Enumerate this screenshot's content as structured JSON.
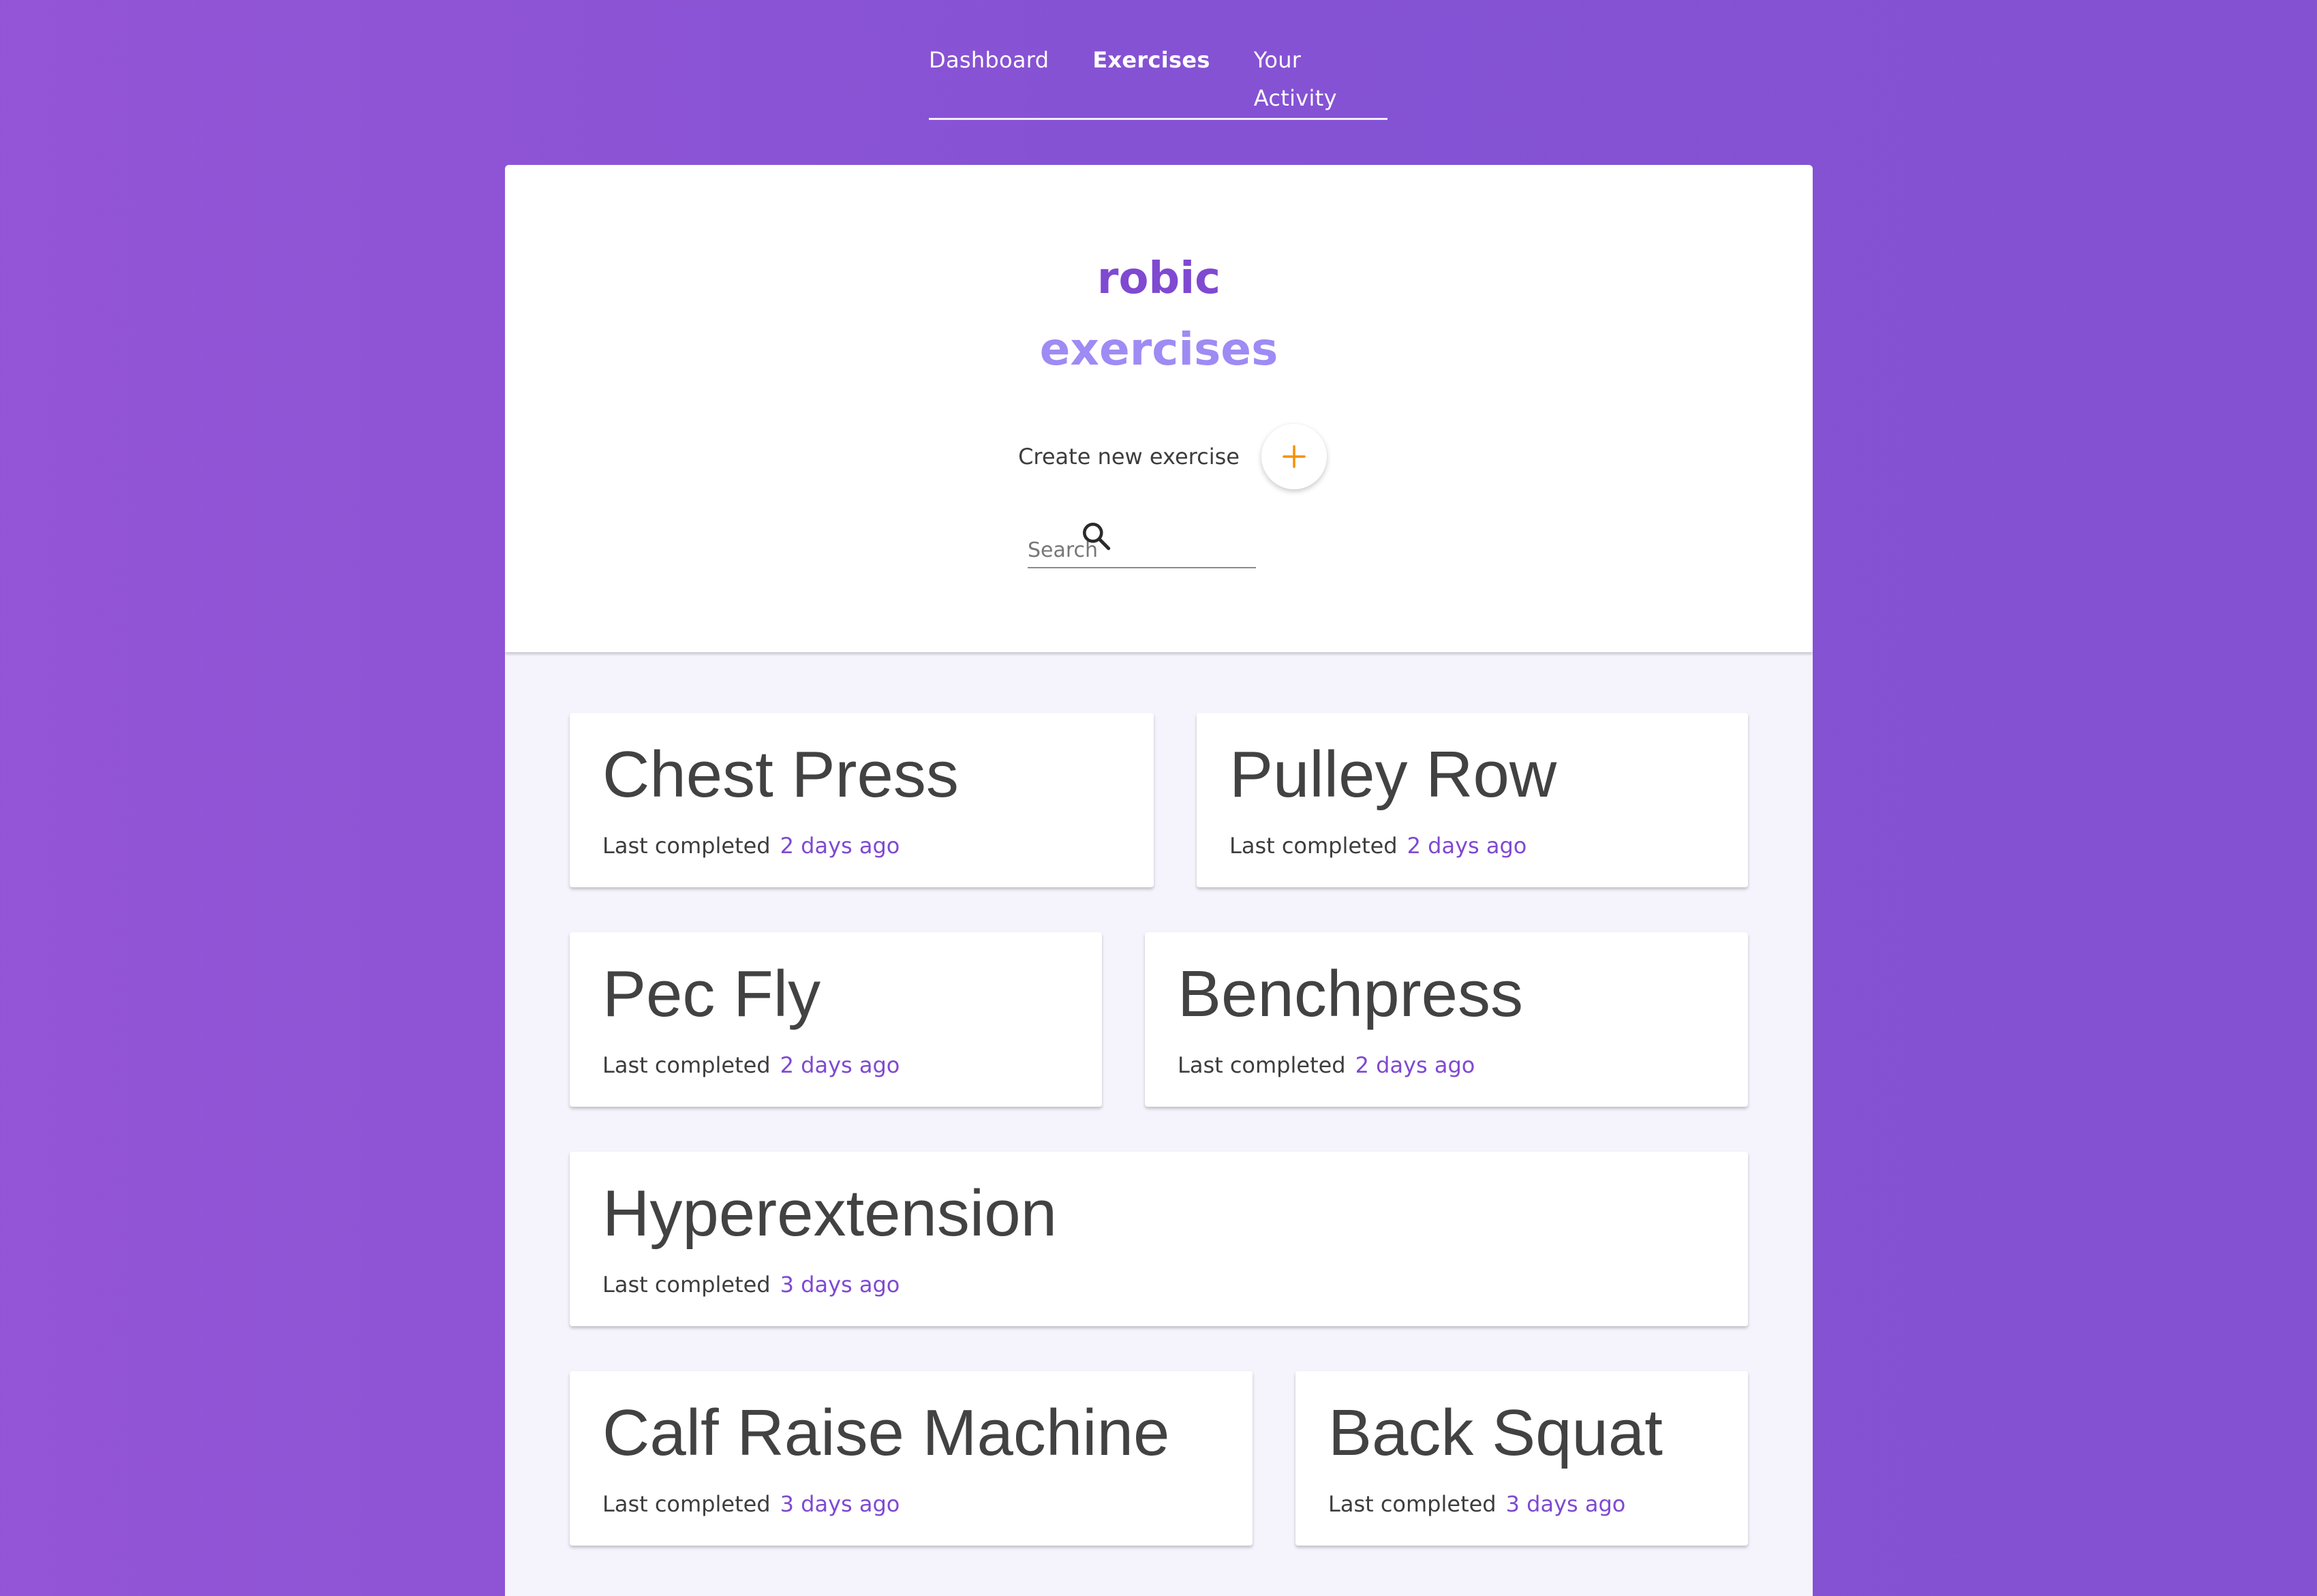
{
  "nav": {
    "items": [
      {
        "label": "Dashboard",
        "active": false
      },
      {
        "label": "Exercises",
        "active": true
      },
      {
        "label": "Your Activity",
        "active": false
      }
    ]
  },
  "header": {
    "logo": "robic",
    "title": "exercises",
    "create_label": "Create new exercise",
    "add_icon": "plus-icon",
    "search": {
      "placeholder": "Search",
      "value": "",
      "icon": "search-icon"
    }
  },
  "colors": {
    "accent": "#7f49d1",
    "heading": "#9e8bf4",
    "add_icon": "#f59100",
    "background": "#8a53d4"
  },
  "exercises": [
    {
      "name": "Chest Press",
      "meta_label": "Last completed",
      "last_completed": "2 days ago"
    },
    {
      "name": "Pulley Row",
      "meta_label": "Last completed",
      "last_completed": "2 days ago"
    },
    {
      "name": "Pec Fly",
      "meta_label": "Last completed",
      "last_completed": "2 days ago"
    },
    {
      "name": "Benchpress",
      "meta_label": "Last completed",
      "last_completed": "2 days ago"
    },
    {
      "name": "Hyperextension",
      "meta_label": "Last completed",
      "last_completed": "3 days ago"
    },
    {
      "name": "Calf Raise Machine",
      "meta_label": "Last completed",
      "last_completed": "3 days ago"
    },
    {
      "name": "Back Squat",
      "meta_label": "Last completed",
      "last_completed": "3 days ago"
    }
  ]
}
